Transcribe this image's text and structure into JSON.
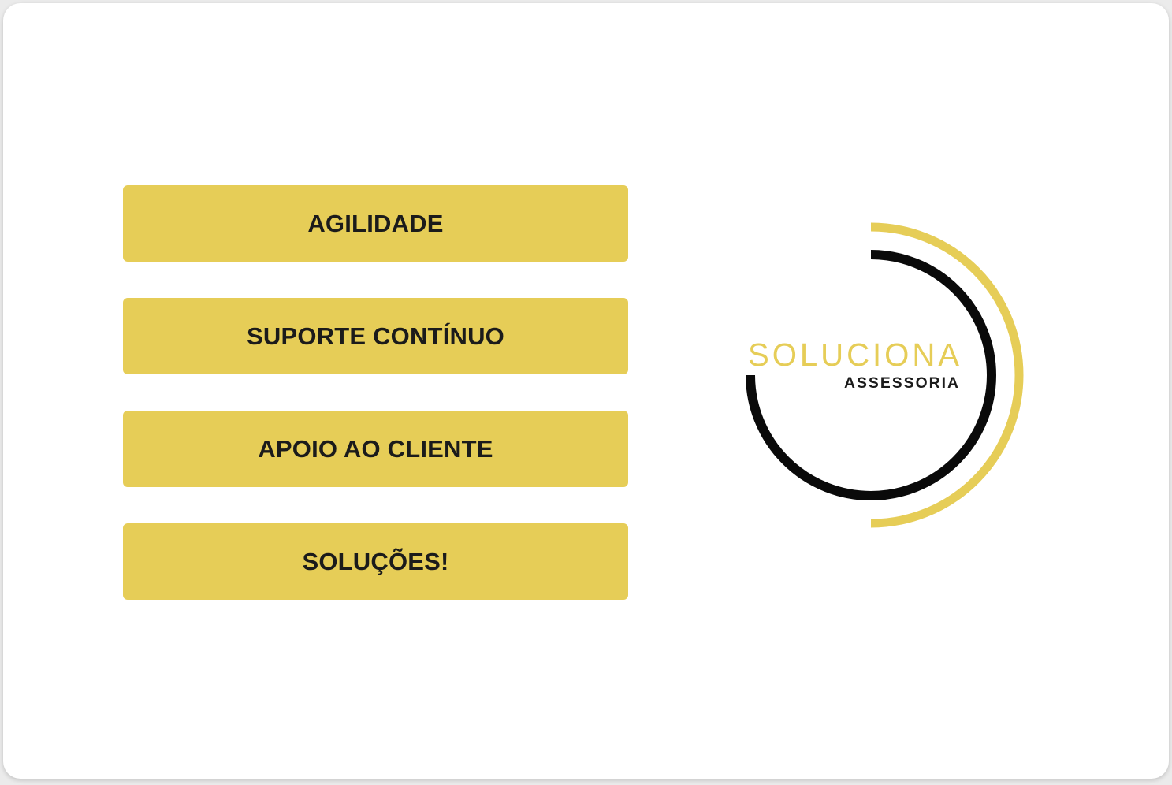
{
  "colors": {
    "background": "#ffffff",
    "accent": "#e6cd57",
    "text": "#1b1b1b",
    "ring_dark": "#0a0a0a"
  },
  "features": [
    {
      "label": "AGILIDADE"
    },
    {
      "label": "SUPORTE CONTÍNUO"
    },
    {
      "label": "APOIO AO CLIENTE"
    },
    {
      "label": "SOLUÇÕES!"
    }
  ],
  "logo": {
    "name": "SOLUCIONA",
    "tagline": "ASSESSORIA"
  }
}
